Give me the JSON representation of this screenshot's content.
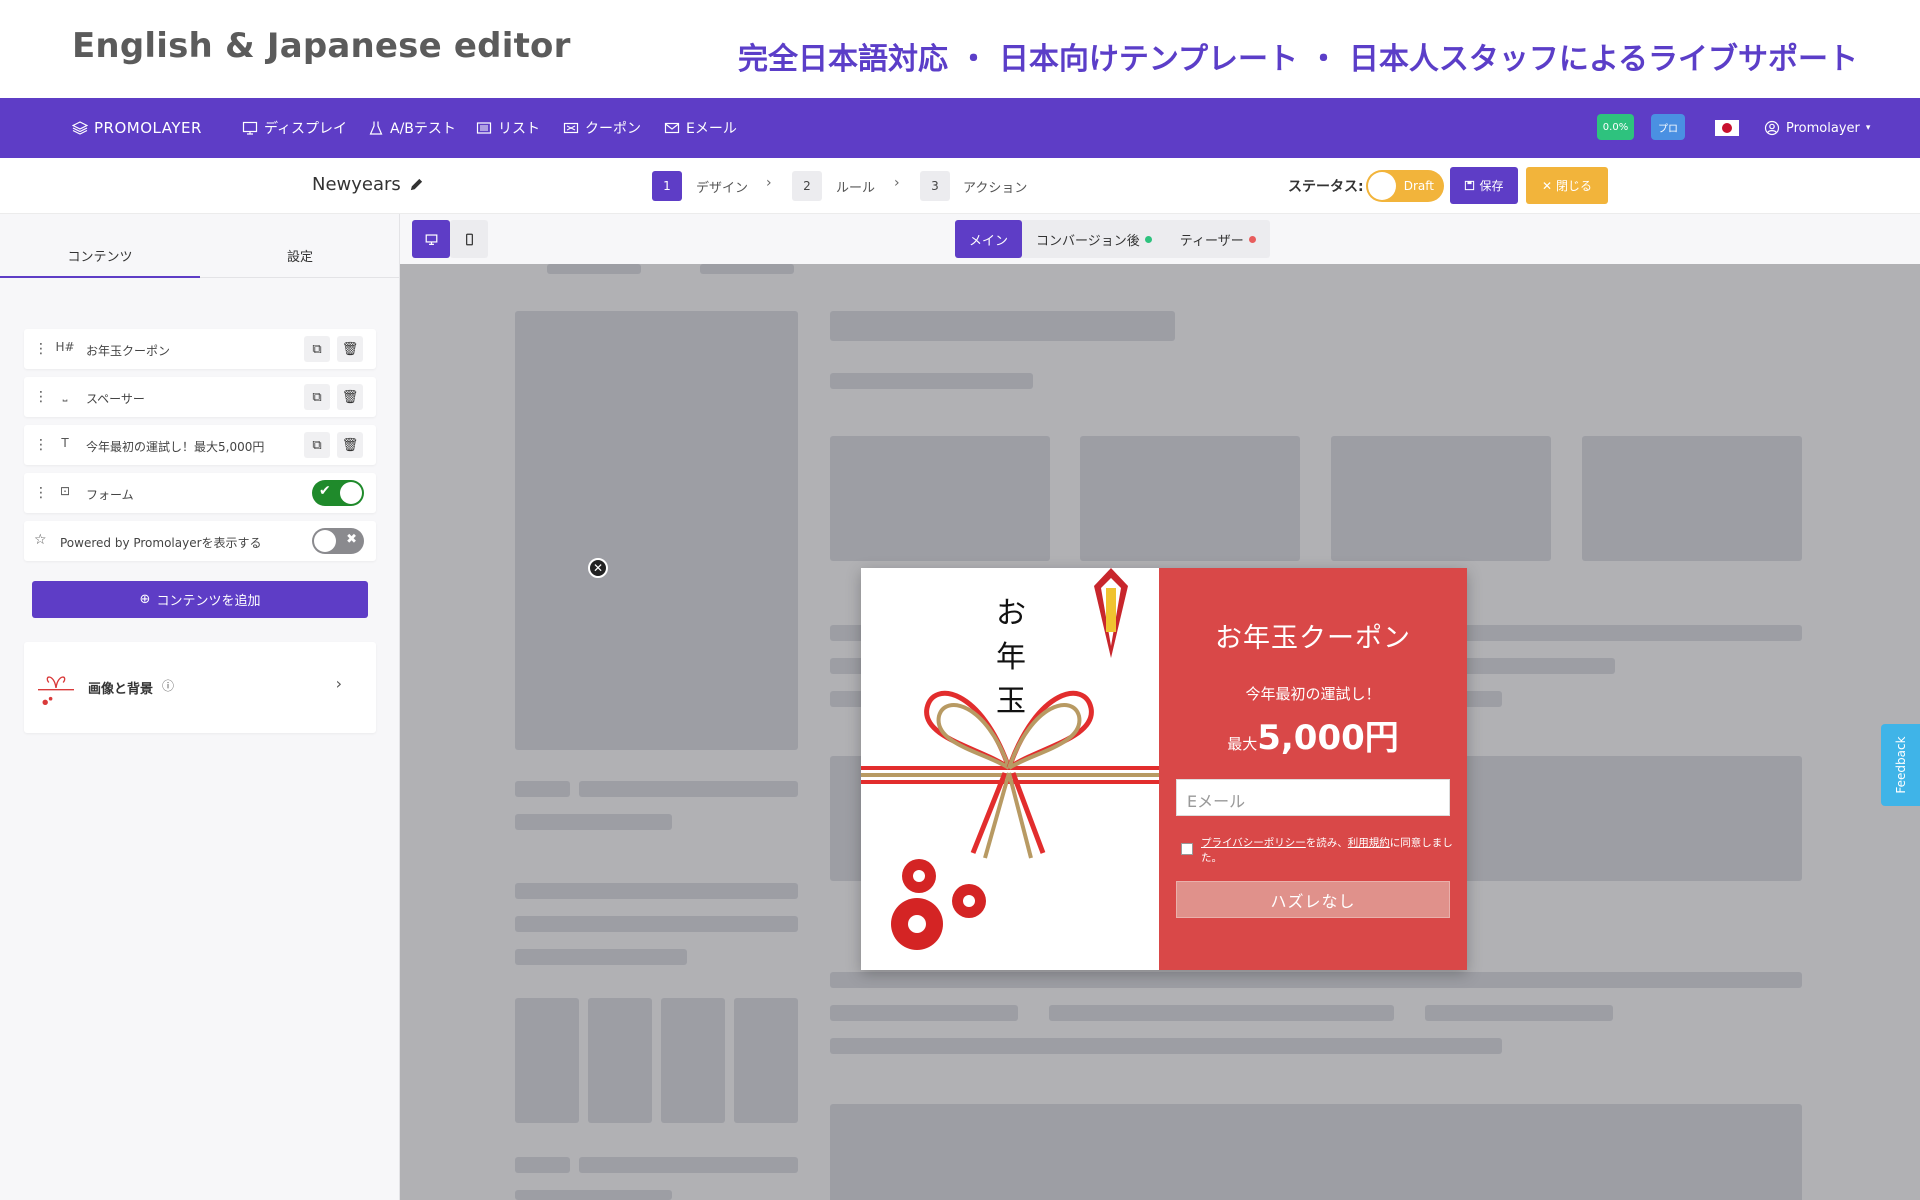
{
  "banner": {
    "left": "English & Japanese editor",
    "right": "完全日本語対応 ・ 日本向けテンプレート ・ 日本人スタッフによるライブサポート"
  },
  "nav": {
    "logo": "PROMOLAYER",
    "items": [
      {
        "label": "ディスプレイ",
        "icon": "display-icon"
      },
      {
        "label": "A/Bテスト",
        "icon": "flask-icon"
      },
      {
        "label": "リスト",
        "icon": "list-icon"
      },
      {
        "label": "クーポン",
        "icon": "coupon-icon"
      },
      {
        "label": "Eメール",
        "icon": "mail-icon"
      }
    ],
    "conversion_badge": "0.0%",
    "plan_badge": "プロ",
    "language_flag": "japan-flag-icon",
    "user": "Promolayer",
    "colors": {
      "primary": "#5e3dc6",
      "badge_green": "#2ec27e",
      "badge_blue": "#4a90e2",
      "accent": "#f2b43b"
    }
  },
  "subheader": {
    "campaign_name": "Newyears",
    "steps": [
      {
        "num": "1",
        "label": "デザイン"
      },
      {
        "num": "2",
        "label": "ルール"
      },
      {
        "num": "3",
        "label": "アクション"
      }
    ],
    "status_label": "ステータス:",
    "status_value": "Draft",
    "save_label": "保存",
    "close_label": "閉じる"
  },
  "left_panel": {
    "tabs": [
      "コンテンツ",
      "設定"
    ],
    "rows": [
      {
        "icon_text": "H#",
        "label": "お年玉クーポン"
      },
      {
        "icon_text": "⎵",
        "label": "スペーサー"
      },
      {
        "icon_text": "T",
        "label": "今年最初の運試し！最大5,000円"
      },
      {
        "icon_text": "⊡",
        "label": "フォーム",
        "toggle": true
      }
    ],
    "powered_by_label": "Powered by Promolayerを表示する",
    "add_content_label": "コンテンツを追加",
    "image_bg_label": "画像と背景"
  },
  "canvas": {
    "view_tabs": [
      {
        "label": "メイン"
      },
      {
        "label": "コンバージョン後",
        "dot_color": "#2ec27e"
      },
      {
        "label": "ティーザー",
        "dot_color": "#e85d5d"
      }
    ]
  },
  "popup": {
    "noshi_text": [
      "お",
      "年",
      "玉"
    ],
    "title": "お年玉クーポン",
    "subtitle": "今年最初の運試し！",
    "amount_prefix": "最大",
    "amount": "5,000円",
    "email_placeholder": "Eメール",
    "consent_link1": "プライバシーポリシー",
    "consent_mid": "を読み、",
    "consent_link2": "利用規約",
    "consent_end": "に同意しました。",
    "submit_label": "ハズレなし",
    "colors": {
      "red": "#d94848"
    }
  },
  "feedback_label": "Feedback"
}
